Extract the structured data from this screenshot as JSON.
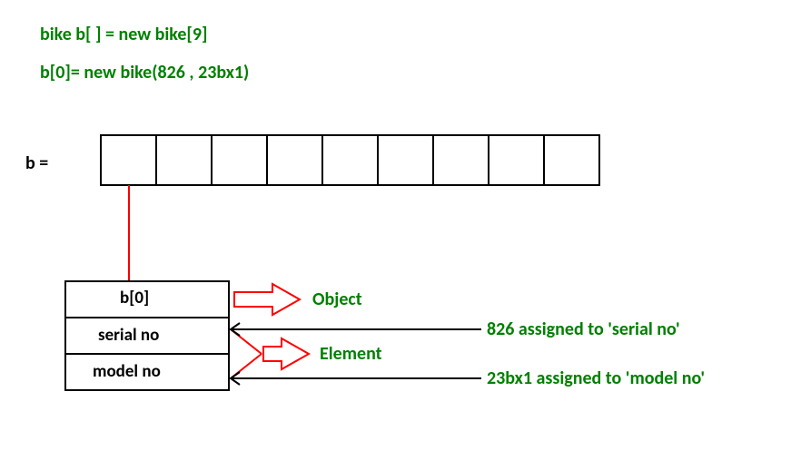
{
  "code": {
    "line1": "bike b[ ] = new bike[9]",
    "line2": "b[0]= new bike(826 , 23bx1)"
  },
  "arrayLabel": "b  =",
  "arraySize": 9,
  "objectBox": {
    "header": "b[0]",
    "field1": "serial no",
    "field2": "model no"
  },
  "labels": {
    "object": "Object",
    "element": "Element",
    "assign1": "826 assigned to 'serial no'",
    "assign2": "23bx1 assigned to 'model no'"
  },
  "colors": {
    "green": "#008000",
    "red": "#ff0000",
    "black": "#000000"
  }
}
